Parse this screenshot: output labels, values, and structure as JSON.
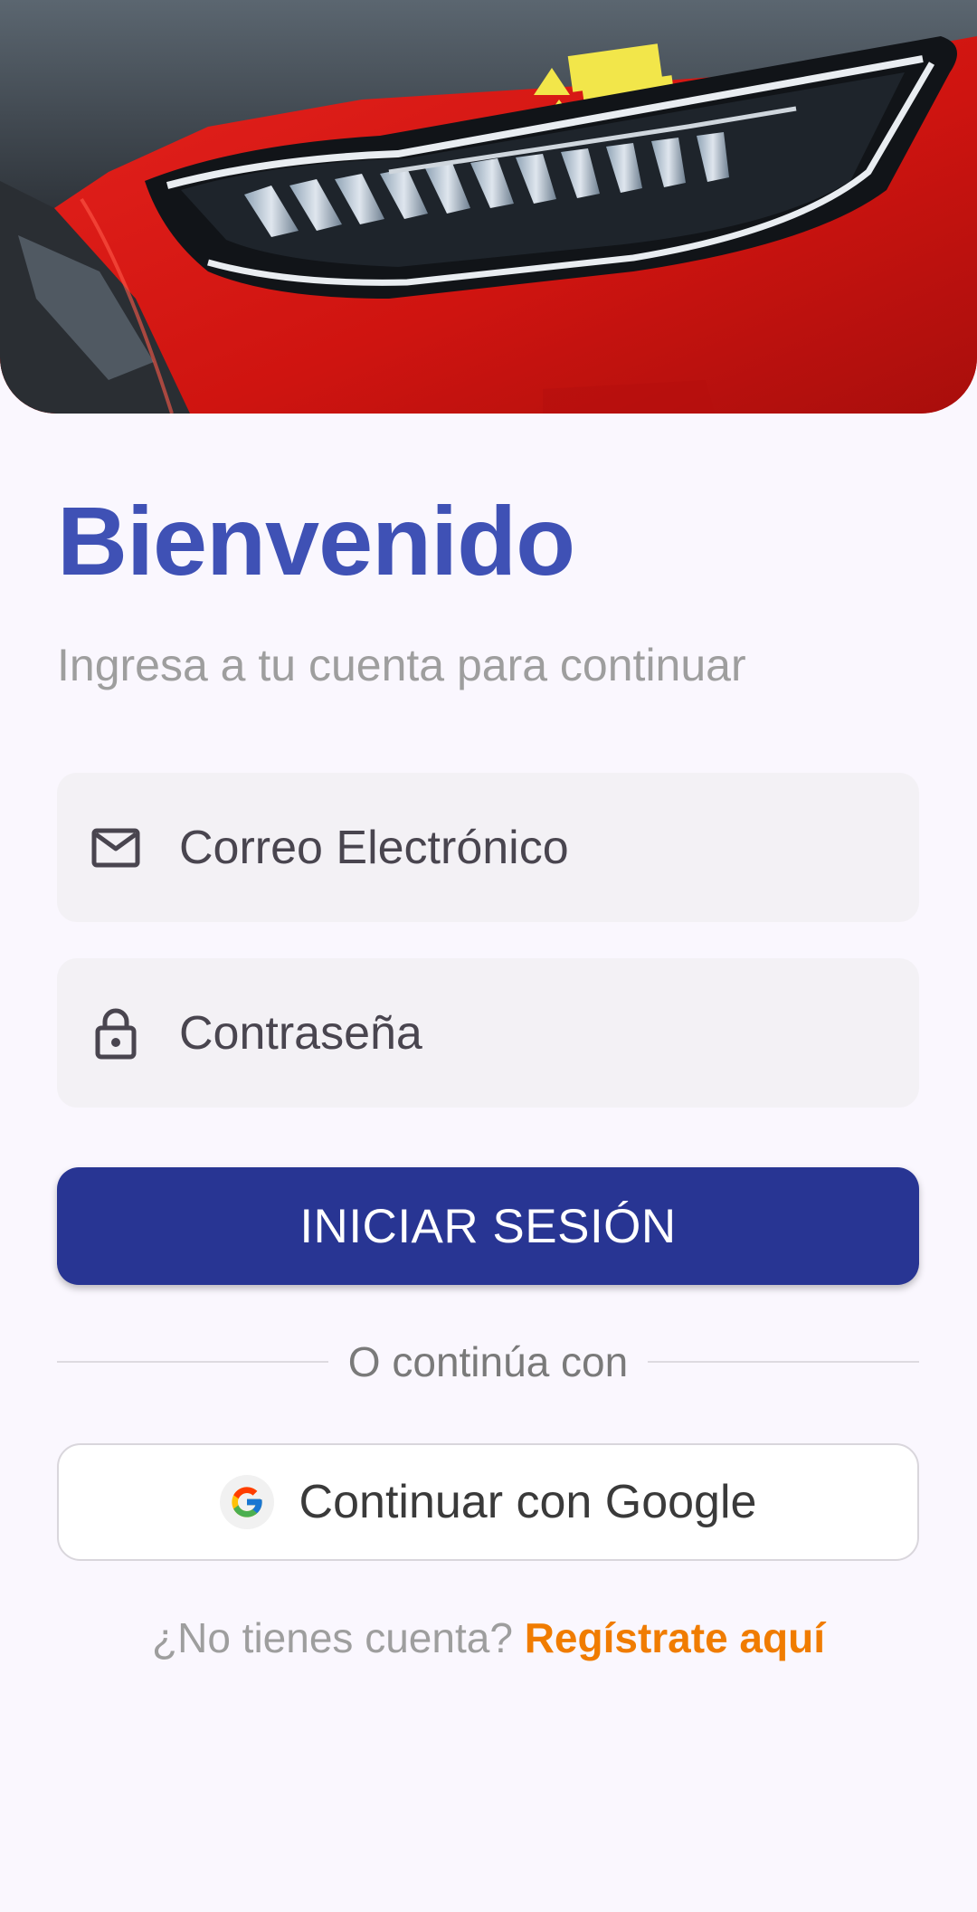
{
  "hero": {
    "image_icon": "car-headlight-image"
  },
  "welcome": {
    "title": "Bienvenido",
    "subtitle": "Ingresa a tu cuenta para continuar"
  },
  "form": {
    "email": {
      "placeholder": "Correo Electrónico",
      "value": "",
      "icon": "mail-icon"
    },
    "password": {
      "placeholder": "Contraseña",
      "value": "",
      "icon": "lock-icon"
    },
    "login_label": "INICIAR SESIÓN"
  },
  "divider": {
    "label": "O continúa con"
  },
  "google": {
    "label": "Continuar con Google",
    "icon": "google-icon"
  },
  "signup": {
    "question": "¿No tienes cuenta?",
    "link": "Regístrate aquí"
  },
  "colors": {
    "background": "#FAF7FE",
    "title": "#3F51B5",
    "primary_button": "#283593",
    "link": "#F07C00",
    "field_background": "#F3F1F5"
  }
}
